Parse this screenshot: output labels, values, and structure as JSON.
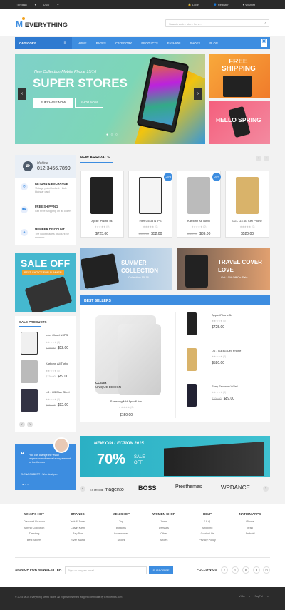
{
  "topbar": {
    "language": "English",
    "currency": "USD",
    "login": "Login",
    "register": "Register",
    "wishlist": "Wishlist"
  },
  "header": {
    "logo": "EVERYTHING",
    "search_placeholder": "Search entire store here..."
  },
  "nav": {
    "category": "CATEGORY",
    "items": [
      "HOME",
      "PAGES",
      "CATEGORY",
      "PRODUCTS",
      "FASHION",
      "SHOES",
      "BLOG"
    ]
  },
  "hero": {
    "subtitle": "New Collection Mobile Phone 15/16",
    "title": "SUPER STORES",
    "btn_purchase": "PURCHASE NOW",
    "btn_shop": "SHOP NOW"
  },
  "promo_free": {
    "line1": "FREE",
    "line2": "SHIPPING"
  },
  "promo_hello": {
    "text": "HELLO SPRING"
  },
  "hotline": {
    "label": "Hotline",
    "number": "012.3456.7899"
  },
  "services": [
    {
      "title": "RETURN & EXCHANGE",
      "desc": "Vintage pallet lucked. Hitch kickstar card"
    },
    {
      "title": "FREE SHIPPING",
      "desc": "Get Free Shipping on all orders"
    },
    {
      "title": "MEMBER DISCOUNT",
      "desc": "The Boot brake's discount for member"
    }
  ],
  "new_arrivals": {
    "title": "NEW ARRIVALS",
    "products": [
      {
        "name": "Apple iPhone 5s",
        "stars": "★★★★★ (0)",
        "price": "$725.00",
        "old": "",
        "badge": ""
      },
      {
        "name": "Inter Cloud N IPS",
        "stars": "★★★★★ (0)",
        "price": "$52.00",
        "old": "$150.00",
        "badge": "-20%"
      },
      {
        "name": "Karbonn All Turbo",
        "stars": "★★★★★ (0)",
        "price": "$89.00",
        "old": "$120.00",
        "badge": "-20%"
      },
      {
        "name": "LG - G3 4G Cell Phone",
        "stars": "★★★★★ (0)",
        "price": "$520.00",
        "old": "",
        "badge": ""
      }
    ]
  },
  "sale_banner": {
    "title": "SALE OFF",
    "subtitle": "BEST CHOICE FOR SUMMER"
  },
  "summer_banner": {
    "title": "SUMMER COLLECTION",
    "subtitle": "Collection 15-16"
  },
  "travel_banner": {
    "title": "TRAVEL COVER LOVE",
    "subtitle": "Get 10% Off On Sale"
  },
  "sale_products": {
    "title": "SALE PRODUCTS",
    "items": [
      {
        "name": "Inter Cloud N IPS",
        "stars": "★★★★★ (0)",
        "price": "$52.00",
        "old": "$150.00"
      },
      {
        "name": "Karbonn All Turbo",
        "stars": "★★★★★ (0)",
        "price": "$89.00",
        "old": "$120.00"
      },
      {
        "name": "LG - G3 Blue Steel",
        "stars": "★★★★★ (0)",
        "price": "$92.00",
        "old": "$120.00"
      }
    ]
  },
  "best_sellers": {
    "title": "BEST SELLERS",
    "featured": {
      "tag1": "CLEAR",
      "tag2": "UNIQUE DESIGN",
      "name": "Samsung MH-Apcoff Acs",
      "stars": "★★★★★ (0)",
      "price": "$150.00"
    },
    "items": [
      {
        "name": "Apple iPhone 5s",
        "stars": "★★★★★ (0)",
        "price": "$725.00",
        "old": ""
      },
      {
        "name": "LG - G3 4G Cell Phone",
        "stars": "★★★★★ (0)",
        "price": "$520.00",
        "old": ""
      },
      {
        "name": "Sony Ericsson W8a1",
        "stars": "★★★★★ (0)",
        "price": "$89.00",
        "old": "$100.00"
      }
    ]
  },
  "testimonial": {
    "text": "You can change the visual appearance of almost every element of the themes",
    "author": "ELENA GILBERT",
    "role": "Web designer"
  },
  "collection": {
    "title": "NEW COLLECTION 2015",
    "percent": "70%",
    "sale": "SALE",
    "off": "OFF"
  },
  "brands": [
    "EXTREME",
    "magento",
    "BOSS",
    "Presthemes",
    "WPDANCE"
  ],
  "footer": {
    "columns": [
      {
        "title": "WHAT'S HOT",
        "items": [
          "Discount Voucher",
          "Spring Collection",
          "Trending",
          "Best Sellers"
        ]
      },
      {
        "title": "BRANDS",
        "items": [
          "Jack & Jones",
          "Calvin Klein",
          "Ray Ban",
          "River Island"
        ]
      },
      {
        "title": "MEN SHOP",
        "items": [
          "Top",
          "Bottoms",
          "Accessories",
          "Shoes"
        ]
      },
      {
        "title": "WOMEN SHOP",
        "items": [
          "Jeans",
          "Dresses",
          "Other",
          "Shoes"
        ]
      },
      {
        "title": "HELP",
        "items": [
          "F.A.Q.",
          "Shipping",
          "Contact Us",
          "Privacy Policy"
        ]
      },
      {
        "title": "NATION APPS",
        "items": [
          "iPhone",
          "iPad",
          "Android"
        ]
      }
    ],
    "newsletter_label": "SIGN UP FOR NEWSLETTER",
    "newsletter_placeholder": "Sign up for your email ...",
    "subscribe": "SUBSCRIBE",
    "follow": "FOLLOW US"
  },
  "copyright": "© 2015 MGS Everything Demo Store. All Rights Reserved Magento Template by EHThemes.com",
  "payments": [
    "VISA",
    "PayPal"
  ]
}
